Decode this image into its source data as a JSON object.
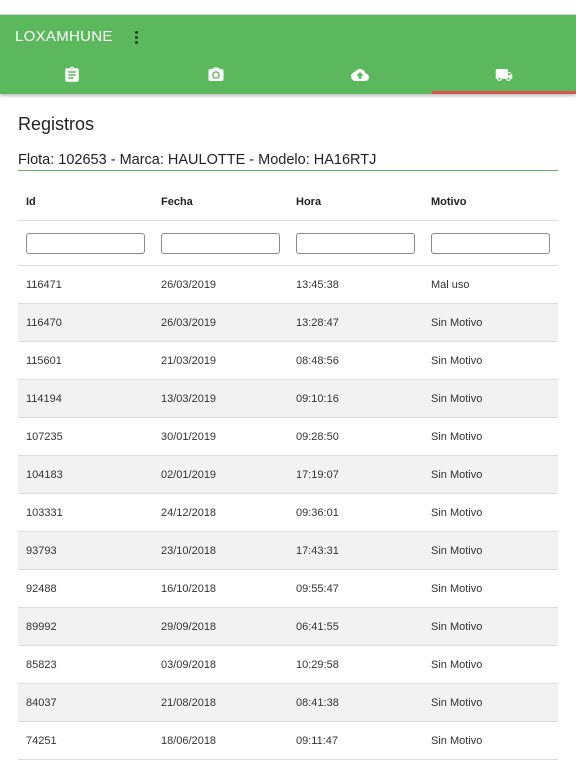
{
  "app": {
    "title": "LOXAMHUNE"
  },
  "tabs": [
    {
      "icon": "clipboard-icon",
      "active": false
    },
    {
      "icon": "camera-icon",
      "active": false
    },
    {
      "icon": "cloud-upload-icon",
      "active": false
    },
    {
      "icon": "truck-icon",
      "active": true
    }
  ],
  "colors": {
    "appbar": "#5cb85c",
    "active_tab_indicator": "#d9534f",
    "icon": "#ffffff"
  },
  "page": {
    "title": "Registros",
    "subtitle": "Flota: 102653 - Marca: HAULOTTE - Modelo: HA16RTJ"
  },
  "table": {
    "headers": {
      "id": "Id",
      "fecha": "Fecha",
      "hora": "Hora",
      "motivo": "Motivo"
    },
    "filters": {
      "id": "",
      "fecha": "",
      "hora": "",
      "motivo": ""
    },
    "rows": [
      {
        "id": "116471",
        "fecha": "26/03/2019",
        "hora": "13:45:38",
        "motivo": "Mal uso"
      },
      {
        "id": "116470",
        "fecha": "26/03/2019",
        "hora": "13:28:47",
        "motivo": "Sin Motivo"
      },
      {
        "id": "115601",
        "fecha": "21/03/2019",
        "hora": "08:48:56",
        "motivo": "Sin Motivo"
      },
      {
        "id": "114194",
        "fecha": "13/03/2019",
        "hora": "09:10:16",
        "motivo": "Sin Motivo"
      },
      {
        "id": "107235",
        "fecha": "30/01/2019",
        "hora": "09:28:50",
        "motivo": "Sin Motivo"
      },
      {
        "id": "104183",
        "fecha": "02/01/2019",
        "hora": "17:19:07",
        "motivo": "Sin Motivo"
      },
      {
        "id": "103331",
        "fecha": "24/12/2018",
        "hora": "09:36:01",
        "motivo": "Sin Motivo"
      },
      {
        "id": "93793",
        "fecha": "23/10/2018",
        "hora": "17:43:31",
        "motivo": "Sin Motivo"
      },
      {
        "id": "92488",
        "fecha": "16/10/2018",
        "hora": "09:55:47",
        "motivo": "Sin Motivo"
      },
      {
        "id": "89992",
        "fecha": "29/09/2018",
        "hora": "06:41:55",
        "motivo": "Sin Motivo"
      },
      {
        "id": "85823",
        "fecha": "03/09/2018",
        "hora": "10:29:58",
        "motivo": "Sin Motivo"
      },
      {
        "id": "84037",
        "fecha": "21/08/2018",
        "hora": "08:41:38",
        "motivo": "Sin Motivo"
      },
      {
        "id": "74251",
        "fecha": "18/06/2018",
        "hora": "09:11:47",
        "motivo": "Sin Motivo"
      }
    ]
  }
}
